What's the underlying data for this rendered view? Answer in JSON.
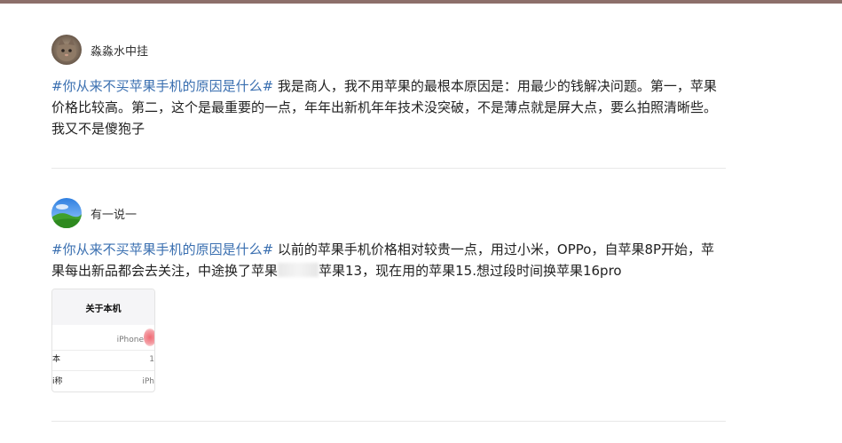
{
  "posts": [
    {
      "username": "淼淼水中挂",
      "hashtag": "#你从来不买苹果手机的原因是什么#",
      "text": " 我是商人，我不用苹果的最根本原因是：用最少的钱解决问题。第一，苹果价格比较高。第二，这个是最重要的一点，年年出新机年年技术没突破，不是薄点就是屏大点，要么拍照清晰些。我又不是傻狍子"
    },
    {
      "username": "有一说一",
      "hashtag": "#你从来不买苹果手机的原因是什么#",
      "text_before_redact": " 以前的苹果手机价格相对较贵一点，用过小米，OPPo，自苹果8P开始，苹果每出新品都会去关注，中途换了苹果",
      "text_after_redact": "苹果13，现在用的苹果15.想过段时间换苹果16pro",
      "image": {
        "title": "关于本机",
        "device_label": "iPhone",
        "rows": [
          {
            "key": "本",
            "value": "1"
          },
          {
            "key": "i称",
            "value": "iPh"
          }
        ]
      }
    }
  ],
  "colors": {
    "hashtag": "#3a6fb0",
    "top_bar": "#8c6f6a",
    "divider": "#e8e8e8"
  }
}
